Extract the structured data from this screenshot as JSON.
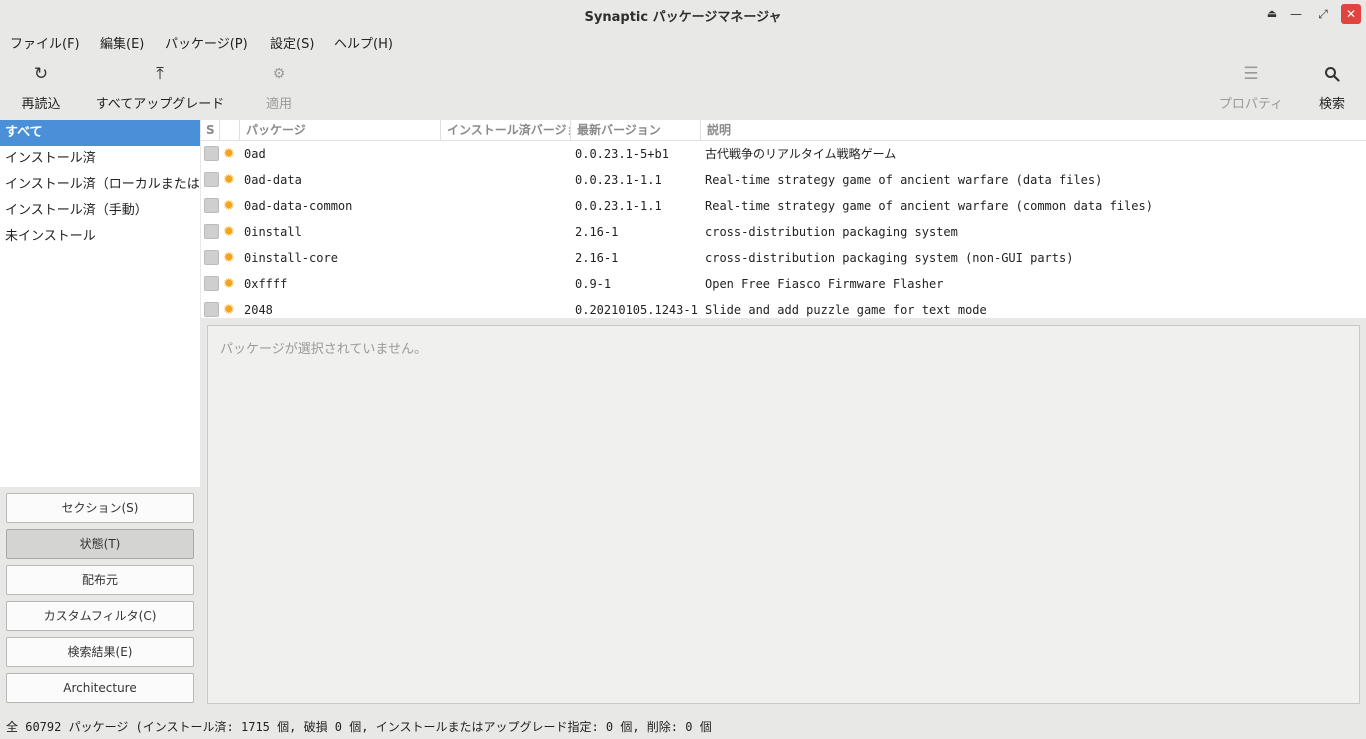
{
  "window": {
    "title": "Synaptic パッケージマネージャ"
  },
  "menu": [
    "ファイル(F)",
    "編集(E)",
    "パッケージ(P)",
    "設定(S)",
    "ヘルプ(H)"
  ],
  "toolbar": {
    "reload": "再読込",
    "upgrade_all": "すべてアップグレード",
    "apply": "適用",
    "properties": "プロパティ",
    "search": "検索"
  },
  "sidebar": {
    "items": [
      "すべて",
      "インストール済",
      "インストール済（ローカルまたは",
      "インストール済（手動）",
      "未インストール"
    ]
  },
  "filter_buttons": [
    "セクション(S)",
    "状態(T)",
    "配布元",
    "カスタムフィルタ(C)",
    "検索結果(E)",
    "Architecture"
  ],
  "columns": {
    "status": "S",
    "package": "パッケージ",
    "installed_version": "インストール済バージョン",
    "latest_version": "最新バージョン",
    "description": "説明"
  },
  "packages": [
    {
      "name": "0ad",
      "latest": "0.0.23.1-5+b1",
      "desc": "古代戦争のリアルタイム戦略ゲーム"
    },
    {
      "name": "0ad-data",
      "latest": "0.0.23.1-1.1",
      "desc": "Real-time strategy game of ancient warfare (data files)"
    },
    {
      "name": "0ad-data-common",
      "latest": "0.0.23.1-1.1",
      "desc": "Real-time strategy game of ancient warfare (common data files)"
    },
    {
      "name": "0install",
      "latest": "2.16-1",
      "desc": "cross-distribution packaging system"
    },
    {
      "name": "0install-core",
      "latest": "2.16-1",
      "desc": "cross-distribution packaging system (non-GUI parts)"
    },
    {
      "name": "0xffff",
      "latest": "0.9-1",
      "desc": "Open Free Fiasco Firmware Flasher"
    },
    {
      "name": "2048",
      "latest": "0.20210105.1243-1",
      "desc": "Slide and add puzzle game for text mode"
    }
  ],
  "details": {
    "message": "パッケージが選択されていません。"
  },
  "statusbar": {
    "text": "全 60792 パッケージ (インストール済: 1715 個, 破損 0 個, インストールまたはアップグレード指定: 0 個, 削除: 0 個"
  }
}
